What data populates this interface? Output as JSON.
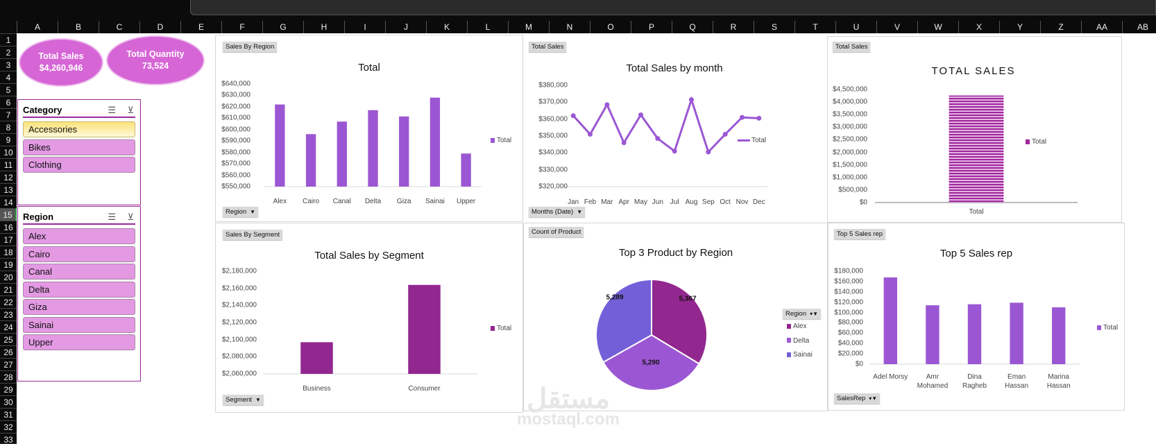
{
  "sheet": {
    "columns": [
      "A",
      "B",
      "C",
      "D",
      "E",
      "F",
      "G",
      "H",
      "I",
      "J",
      "K",
      "L",
      "M",
      "N",
      "O",
      "P",
      "Q",
      "R",
      "S",
      "T",
      "U",
      "V",
      "W",
      "X",
      "Y",
      "Z",
      "AA",
      "AB"
    ],
    "rows": [
      "1",
      "2",
      "3",
      "4",
      "5",
      "6",
      "7",
      "8",
      "9",
      "10",
      "11",
      "12",
      "13",
      "14",
      "15",
      "16",
      "17",
      "18",
      "19",
      "20",
      "21",
      "22",
      "23",
      "24",
      "25",
      "26",
      "27",
      "28",
      "29",
      "30",
      "31",
      "32",
      "33"
    ],
    "selected_row": "15"
  },
  "kpis": [
    {
      "label": "Total Sales",
      "value": "$4,260,946"
    },
    {
      "label": "Total Quantity",
      "value": "73,524"
    }
  ],
  "slicers": {
    "category": {
      "title": "Category",
      "items": [
        "Accessories",
        "Bikes",
        "Clothing"
      ],
      "selected": "Accessories"
    },
    "region": {
      "title": "Region",
      "items": [
        "Alex",
        "Cairo",
        "Canal",
        "Delta",
        "Giza",
        "Sainai",
        "Upper"
      ]
    }
  },
  "colors": {
    "bar": "#9B57D3",
    "segment": "#92278F",
    "kpi": "#D666D6",
    "alex": "#92278F",
    "delta": "#9B57D3",
    "sainai": "#7360D8"
  },
  "watermark": {
    "arabic": "مستقل",
    "latin": "mostaql.com"
  },
  "chart_data": [
    {
      "id": "region",
      "type": "bar",
      "tag": "Sales By Region",
      "title": "Total",
      "filter_button": "Region",
      "legend": "Total",
      "categories": [
        "Alex",
        "Cairo",
        "Canal",
        "Delta",
        "Giza",
        "Sainai",
        "Upper"
      ],
      "values": [
        622000,
        596000,
        607000,
        617000,
        611500,
        628000,
        579000
      ],
      "ylim": [
        550000,
        640000
      ],
      "yticks": [
        "$550,000",
        "$560,000",
        "$570,000",
        "$580,000",
        "$590,000",
        "$600,000",
        "$610,000",
        "$620,000",
        "$630,000",
        "$640,000"
      ]
    },
    {
      "id": "month",
      "type": "line",
      "tag": "Total Sales",
      "title": "Total Sales by month",
      "filter_button": "Months (Date)",
      "legend": "Total",
      "categories": [
        "Jan",
        "Feb",
        "Mar",
        "Apr",
        "May",
        "Jun",
        "Jul",
        "Aug",
        "Sep",
        "Oct",
        "Nov",
        "Dec"
      ],
      "values": [
        362000,
        351000,
        368500,
        346000,
        362500,
        348500,
        341000,
        371500,
        340500,
        351000,
        361000,
        360500
      ],
      "ylim": [
        320000,
        380000
      ],
      "yticks": [
        "$320,000",
        "$330,000",
        "$340,000",
        "$350,000",
        "$360,000",
        "$370,000",
        "$380,000"
      ]
    },
    {
      "id": "total",
      "type": "bar",
      "tag": "Total Sales",
      "title": "TOTAL SALES",
      "legend": "Total",
      "categories": [
        "Total"
      ],
      "values": [
        4260946
      ],
      "ylim": [
        0,
        4500000
      ],
      "yticks": [
        "$0",
        "$500,000",
        "$1,000,000",
        "$1,500,000",
        "$2,000,000",
        "$2,500,000",
        "$3,000,000",
        "$3,500,000",
        "$4,000,000",
        "$4,500,000"
      ]
    },
    {
      "id": "segment",
      "type": "bar",
      "tag": "Sales By Segment",
      "title": "Total Sales by Segment",
      "filter_button": "Segment",
      "legend": "Total",
      "categories": [
        "Business",
        "Consumer"
      ],
      "values": [
        2097000,
        2164000
      ],
      "ylim": [
        2060000,
        2180000
      ],
      "yticks": [
        "$2,060,000",
        "$2,080,000",
        "$2,100,000",
        "$2,120,000",
        "$2,140,000",
        "$2,160,000",
        "$2,180,000"
      ]
    },
    {
      "id": "pie",
      "type": "pie",
      "tag": "Count of Product",
      "title": "Top 3 Product by Region",
      "filter_button": "Region",
      "categories": [
        "Alex",
        "Delta",
        "Sainai"
      ],
      "values": [
        5367,
        5290,
        5289
      ],
      "labels": [
        "5,367",
        "5,290",
        "5,289"
      ]
    },
    {
      "id": "reps",
      "type": "bar",
      "tag": "Top 5 Sales rep",
      "title": "Top 5 Sales rep",
      "filter_button": "SalesRep",
      "legend": "Total",
      "categories": [
        "Adel Morsy",
        "Amr Mohamed",
        "Dina Ragheb",
        "Eman Hassan",
        "Marina Hassan"
      ],
      "values": [
        168000,
        114000,
        116000,
        119000,
        110000
      ],
      "ylim": [
        0,
        180000
      ],
      "yticks": [
        "$0",
        "$20,000",
        "$40,000",
        "$60,000",
        "$80,000",
        "$100,000",
        "$120,000",
        "$140,000",
        "$160,000",
        "$180,000"
      ]
    }
  ]
}
